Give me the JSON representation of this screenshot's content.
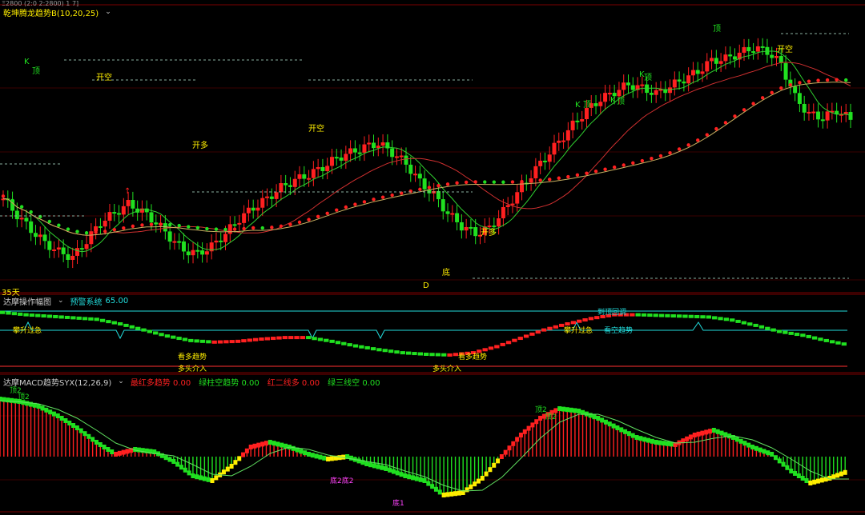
{
  "colors": {
    "up": "#ff2020",
    "down": "#20e020",
    "yellow": "#ffee00",
    "grid": "#7a0000",
    "cyan": "#22dddd",
    "magenta": "#ff44ff",
    "bg": "#000000"
  },
  "top": {
    "clip": "Ξ2800  (2:0 2:2800)  1 7]",
    "title": "乾坤腾龙趋势B(10,20,25)",
    "chevron": "chevron-down-icon"
  },
  "main_marks": [
    {
      "t": "K",
      "c": "#20e020"
    },
    {
      "t": "顶",
      "c": "#20e020"
    },
    {
      "t": "开空",
      "c": "#ffee00"
    },
    {
      "t": "开多",
      "c": "#ffee00"
    },
    {
      "t": "开空",
      "c": "#ffee00"
    },
    {
      "t": "开多",
      "c": "#ffee00"
    },
    {
      "t": "底",
      "c": "#ffee00"
    },
    {
      "t": "D",
      "c": "#ffee00"
    },
    {
      "t": "K",
      "c": "#20e020"
    },
    {
      "t": "顶",
      "c": "#20e020"
    },
    {
      "t": "K",
      "c": "#20e020"
    },
    {
      "t": "顶",
      "c": "#20e020"
    },
    {
      "t": "K",
      "c": "#20e020"
    },
    {
      "t": "顶",
      "c": "#20e020"
    },
    {
      "t": "顶",
      "c": "#20e020"
    },
    {
      "t": "开空",
      "c": "#ffee00"
    },
    {
      "t": "↑",
      "c": "#ff2020"
    }
  ],
  "days": "35天",
  "mid": {
    "title": "达摩操作幅图",
    "alert_label": "预警系统",
    "alert_value": "65.00",
    "labels": [
      {
        "t": "攀升过急",
        "c": "#ffee00"
      },
      {
        "t": "看多趋势",
        "c": "#ffee00"
      },
      {
        "t": "多头介入",
        "c": "#ffee00"
      },
      {
        "t": "看多趋势",
        "c": "#ffee00"
      },
      {
        "t": "多头介入",
        "c": "#ffee00"
      },
      {
        "t": "到顶回调",
        "c": "#22dddd"
      },
      {
        "t": "攀升过急",
        "c": "#ffee00"
      },
      {
        "t": "看空趋势",
        "c": "#22dddd"
      }
    ]
  },
  "bottom": {
    "title": "达摩MACD趋势SYX(12,26,9)",
    "legend": [
      {
        "k": "最红多趋势",
        "v": "0.00",
        "c": "#ff2020"
      },
      {
        "k": "绿柱空趋势",
        "v": "0.00",
        "c": "#20e020"
      },
      {
        "k": "红二线多",
        "v": "0.00",
        "c": "#ff2020"
      },
      {
        "k": "绿三线空",
        "v": "0.00",
        "c": "#20e020"
      }
    ],
    "labels": [
      {
        "t": "顶2",
        "c": "#20e020"
      },
      {
        "t": "顶2",
        "c": "#20e020"
      },
      {
        "t": "底2底2",
        "c": "#ff44ff"
      },
      {
        "t": "底1",
        "c": "#ff44ff"
      },
      {
        "t": "顶2",
        "c": "#20e020"
      },
      {
        "t": "顶2",
        "c": "#20e020"
      }
    ]
  },
  "chart_data": [
    {
      "type": "line",
      "subtype": "candlestick",
      "title": "乾坤腾龙趋势B(10,20,25)",
      "series": [
        {
          "values": [
            1.95,
            1.5,
            1.1,
            0.75,
            0.5,
            0.35,
            0.8,
            1.3,
            1.55,
            1.8,
            1.6,
            1.3,
            0.9,
            0.55,
            0.45,
            0.65,
            1.0,
            1.4,
            1.7,
            1.95,
            2.25,
            2.45,
            2.6,
            2.8,
            3.05,
            3.2,
            3.35,
            3.45,
            3.2,
            2.9,
            2.4,
            2.05,
            1.55,
            1.2,
            1.0,
            1.15,
            1.6,
            2.1,
            2.6,
            3.05,
            3.5,
            3.95,
            4.35,
            4.65,
            4.85,
            5.05,
            4.95,
            4.8,
            5.0,
            5.2,
            5.4,
            5.7,
            5.75,
            5.9,
            6.05,
            5.95,
            5.6,
            4.7,
            4.25,
            4.15,
            4.35,
            4.1
          ]
        }
      ],
      "x": "candle index",
      "y": "relative price"
    },
    {
      "type": "line",
      "title": "达摩操作幅图",
      "series": [
        {
          "values": [
            75,
            72,
            70,
            68,
            66,
            60,
            52,
            44,
            38,
            36,
            37,
            40,
            42,
            42,
            37,
            31,
            26,
            22,
            20,
            19,
            22,
            30,
            41,
            52,
            60,
            67,
            72,
            72,
            71,
            70,
            69,
            65,
            58,
            50,
            45,
            38,
            32
          ]
        }
      ],
      "ylim": [
        0,
        100
      ]
    },
    {
      "type": "bar",
      "title": "达摩MACD趋势SYX(12,26,9)",
      "values": [
        2.4,
        2.3,
        2.1,
        1.7,
        1.2,
        0.6,
        0.1,
        0.3,
        0.2,
        -0.2,
        -0.8,
        -1.0,
        -0.4,
        0.4,
        0.6,
        0.4,
        0.1,
        -0.1,
        0.0,
        -0.3,
        -0.5,
        -0.8,
        -1.0,
        -1.6,
        -1.5,
        -0.9,
        0.0,
        0.9,
        1.6,
        2.0,
        1.9,
        1.6,
        1.2,
        0.8,
        0.6,
        0.5,
        0.9,
        1.1,
        0.8,
        0.4,
        0.1,
        -0.6,
        -1.1,
        -0.9,
        -0.6
      ],
      "ylim": [
        -2,
        2.8
      ]
    }
  ]
}
